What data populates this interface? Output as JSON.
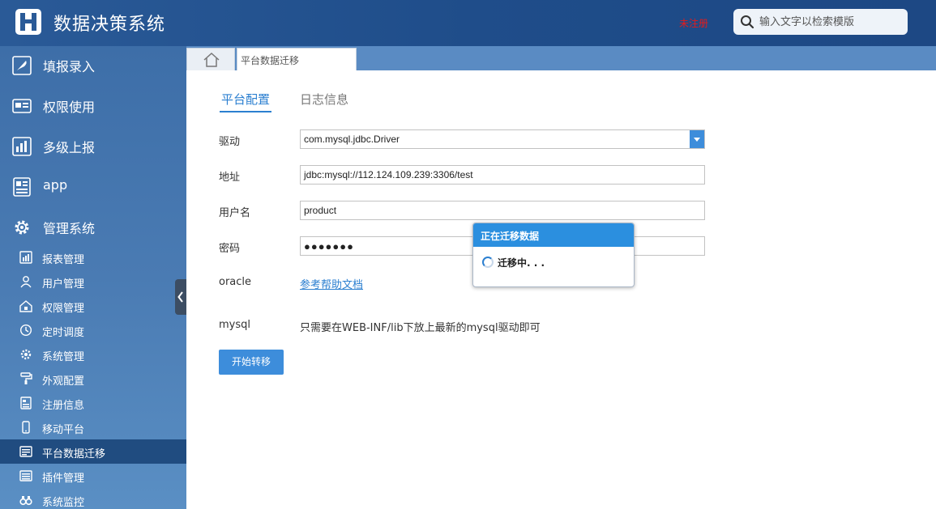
{
  "header": {
    "title": "数据决策系统",
    "unregistered": "未注册",
    "search_placeholder": "输入文字以检索模版"
  },
  "sidebar": {
    "main_items": [
      {
        "label": "填报录入",
        "icon": "feather-icon"
      },
      {
        "label": "权限使用",
        "icon": "permission-card-icon"
      },
      {
        "label": "多级上报",
        "icon": "bar-chart-icon"
      },
      {
        "label": "app",
        "icon": "document-icon"
      },
      {
        "label": "管理系统",
        "icon": "gear-icon"
      }
    ],
    "sub_items": [
      {
        "label": "报表管理",
        "icon": "report-icon"
      },
      {
        "label": "用户管理",
        "icon": "user-icon"
      },
      {
        "label": "权限管理",
        "icon": "lock-house-icon"
      },
      {
        "label": "定时调度",
        "icon": "clock-icon"
      },
      {
        "label": "系统管理",
        "icon": "gear-icon"
      },
      {
        "label": "外观配置",
        "icon": "paint-roller-icon"
      },
      {
        "label": "注册信息",
        "icon": "register-doc-icon"
      },
      {
        "label": "移动平台",
        "icon": "mobile-icon"
      },
      {
        "label": "平台数据迁移",
        "icon": "migrate-icon",
        "active": true
      },
      {
        "label": "插件管理",
        "icon": "plugin-icon"
      },
      {
        "label": "系统监控",
        "icon": "binoculars-icon"
      }
    ]
  },
  "tabs": {
    "active_page": "平台数据迁移"
  },
  "content": {
    "tabs": [
      "平台配置",
      "日志信息"
    ],
    "fields": {
      "driver_label": "驱动",
      "driver_value": "com.mysql.jdbc.Driver",
      "address_label": "地址",
      "address_value": "jdbc:mysql://112.124.109.239:3306/test",
      "username_label": "用户名",
      "username_value": "product",
      "password_label": "密码",
      "password_value": "●●●●●●●",
      "oracle_label": "oracle",
      "oracle_link": "参考帮助文档",
      "mysql_label": "mysql",
      "mysql_note": "只需要在WEB-INF/lib下放上最新的mysql驱动即可"
    },
    "start_button": "开始转移"
  },
  "dialog": {
    "title": "正在迁移数据",
    "message": "迁移中. . ."
  },
  "colors": {
    "accent": "#2b7fd0",
    "header_bg": "#1f4d8a",
    "sidebar_active": "#204c80",
    "unregistered": "#e41b1b"
  }
}
